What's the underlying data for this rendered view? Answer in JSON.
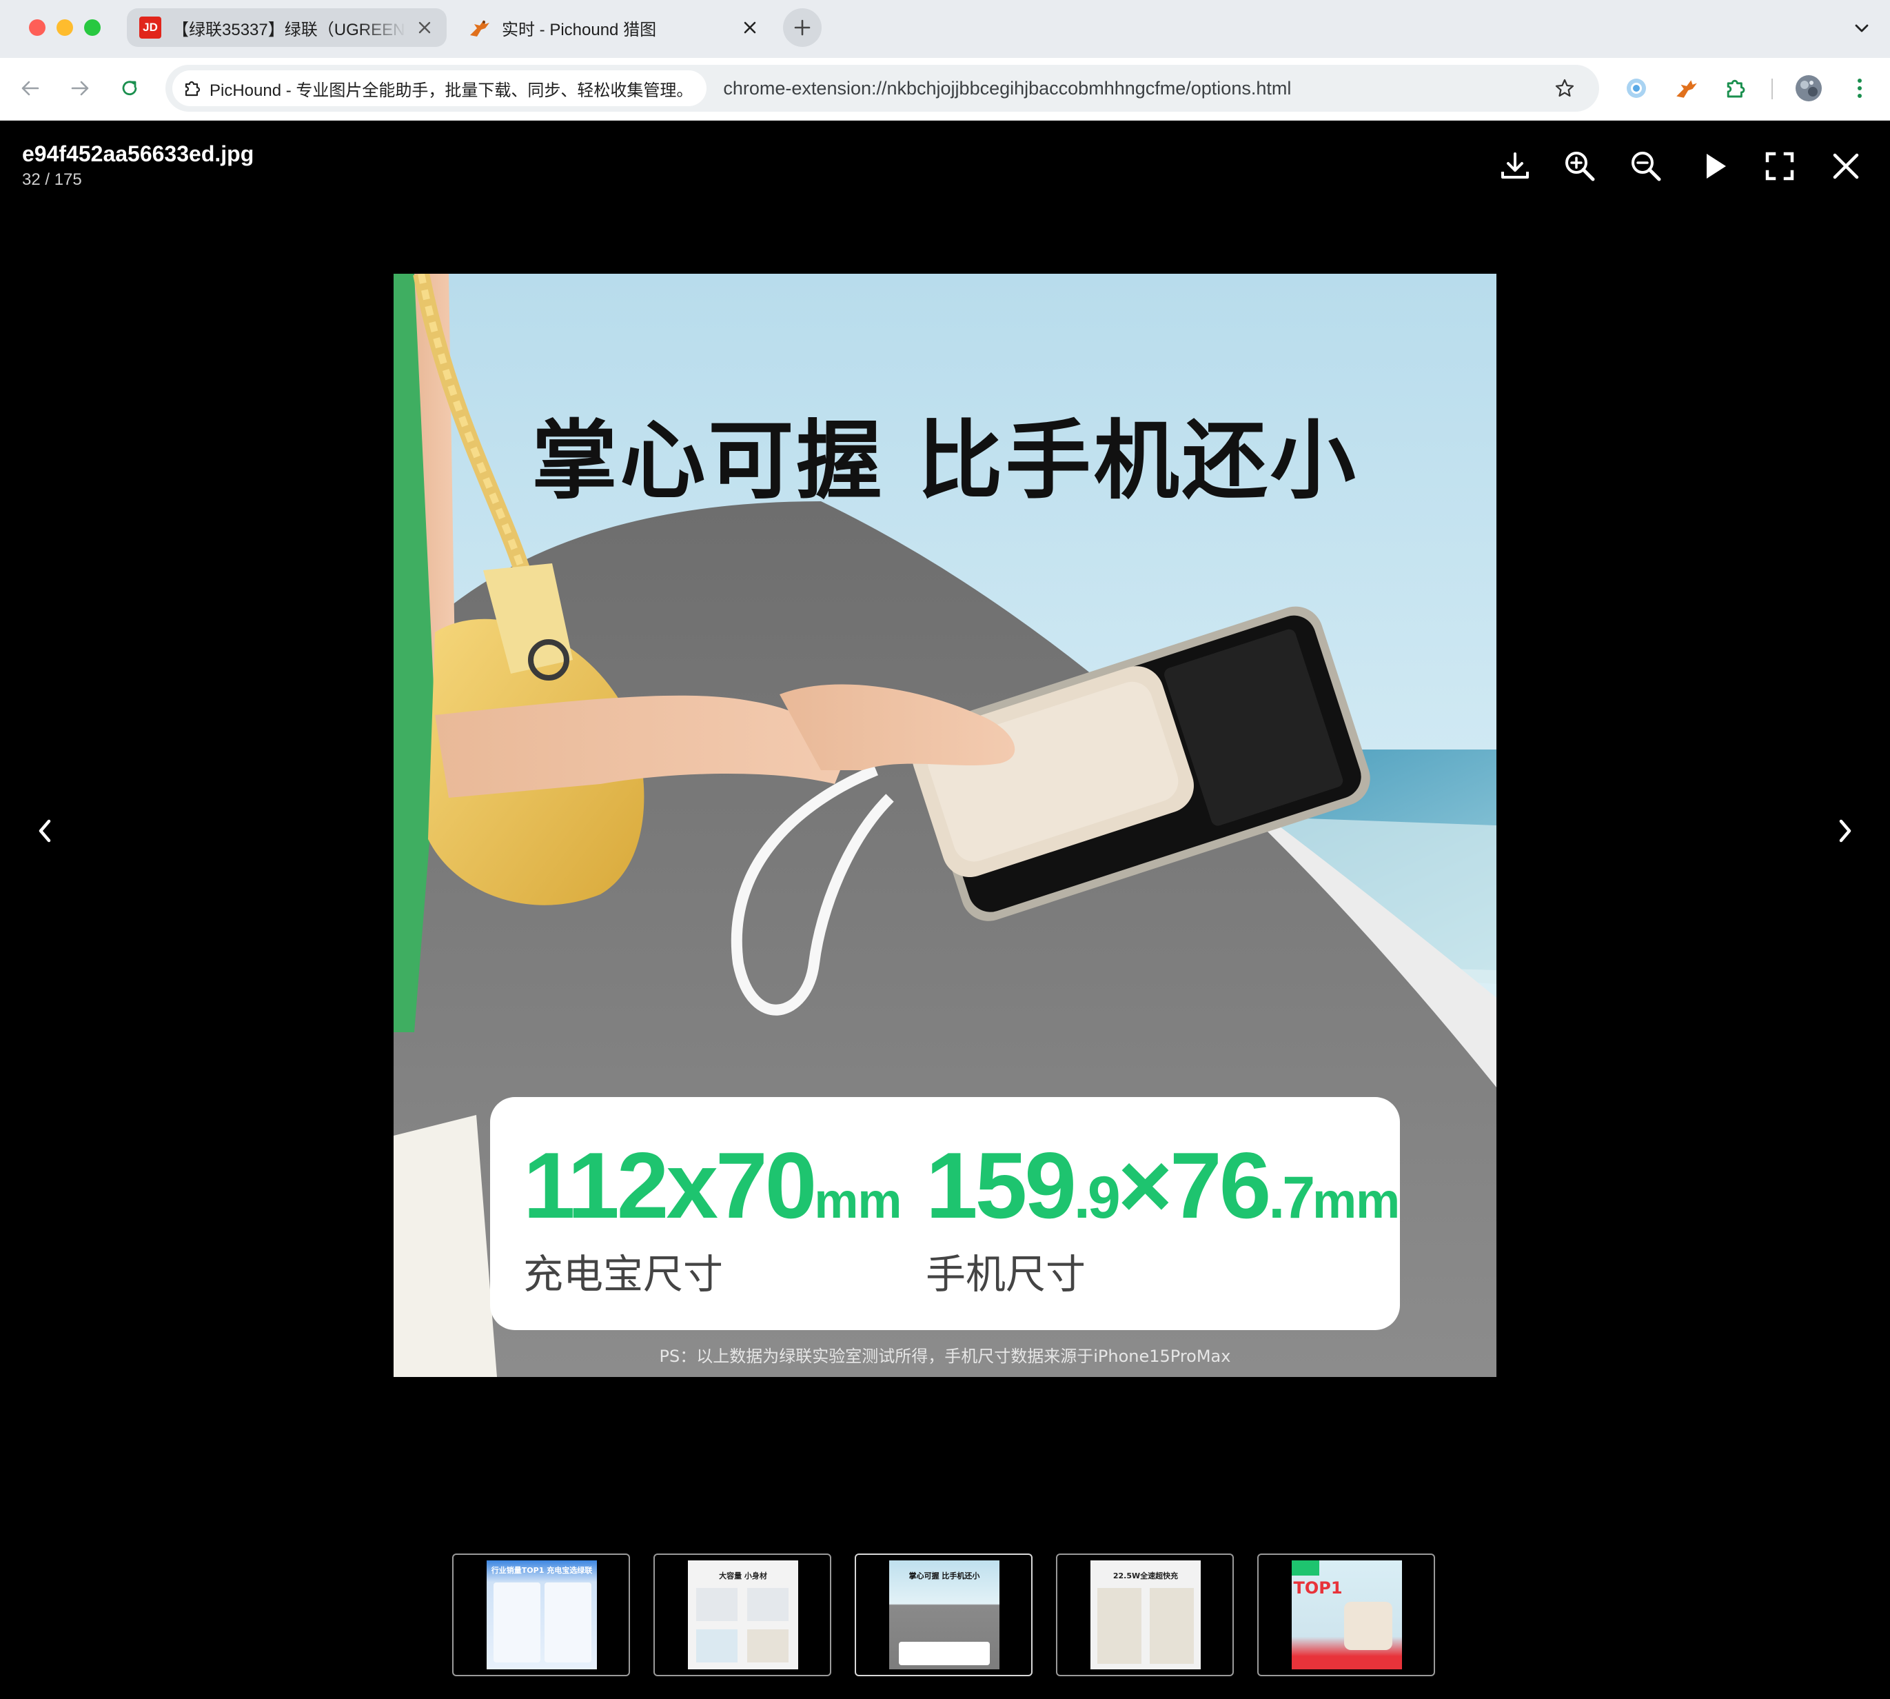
{
  "browser": {
    "tabs": [
      {
        "title": "【绿联35337】绿联（UGREEN",
        "favicon": "JD",
        "active": false
      },
      {
        "title": "实时 - Pichound 猎图",
        "favicon": "pichound-logo",
        "active": true
      }
    ],
    "new_tab_icon": "plus-icon",
    "site_chip": "PicHound - 专业图片全能助手，批量下载、同步、轻松收集管理。",
    "url": "chrome-extension://nkbchjojjbbcegihjbaccobmhhngcfme/options.html",
    "colors": {
      "tabstrip": "#e9ecf0",
      "omnibox": "#edf0f2",
      "accent_green": "#1ec46f"
    }
  },
  "viewer": {
    "file_name": "e94f452aa56633ed.jpg",
    "counter": "32 / 175",
    "toolbar_icons": [
      "download-icon",
      "zoom-in-icon",
      "zoom-out-icon",
      "play-icon",
      "fullscreen-icon",
      "close-icon"
    ],
    "nav_icons": [
      "chevron-left-icon",
      "chevron-right-icon"
    ]
  },
  "image": {
    "headline": "掌心可握 比手机还小",
    "spec_left": {
      "value": "112x70",
      "unit": "mm",
      "label": "充电宝尺寸"
    },
    "spec_right": {
      "value_main": "159",
      "value_small1": ".9",
      "value_mid": "×76",
      "value_small2": ".7",
      "unit": "mm",
      "label": "手机尺寸"
    },
    "footnote": "PS：以上数据为绿联实验室测试所得，手机尺寸数据来源于iPhone15ProMax"
  },
  "thumbnails": [
    {
      "caption": "行业销量TOP1 充电宝选绿联",
      "active": false
    },
    {
      "caption": "大容量 小身材",
      "active": false
    },
    {
      "caption": "掌心可握 比手机还小",
      "active": true
    },
    {
      "caption": "22.5W全速超快充",
      "active": false
    },
    {
      "caption": "TOP1",
      "active": false
    }
  ]
}
